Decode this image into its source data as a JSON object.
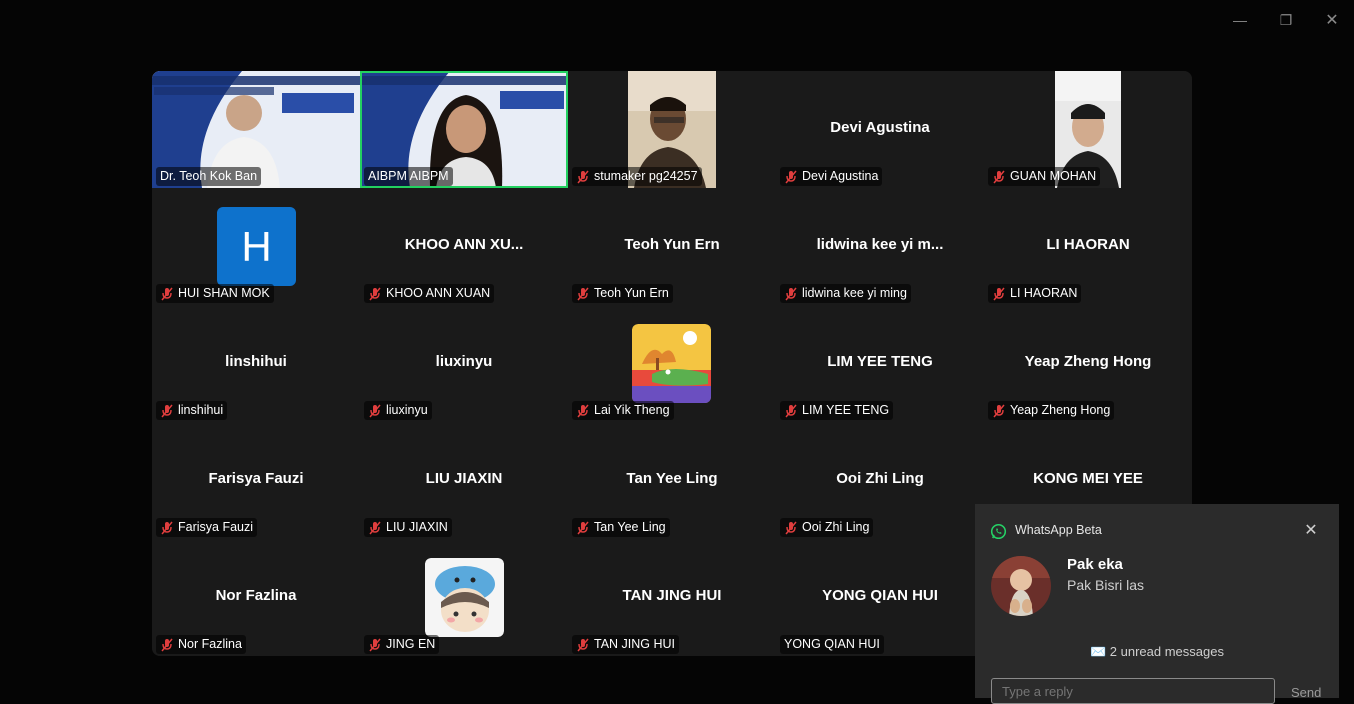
{
  "window": {
    "min_icon": "—",
    "max_icon": "❐",
    "close_icon": "✕"
  },
  "tiles": [
    {
      "name": "Dr. Teoh Kok Ban",
      "label": "Dr. Teoh Kok Ban",
      "muted": false,
      "type": "video"
    },
    {
      "name": "AIBPM AIBPM",
      "label": "AIBPM AIBPM",
      "muted": false,
      "type": "video",
      "active": true
    },
    {
      "name": "stumaker pg24257",
      "label": "stumaker pg24257",
      "muted": true,
      "type": "video"
    },
    {
      "name": "Devi Agustina",
      "label": "Devi Agustina",
      "muted": true,
      "type": "name"
    },
    {
      "name": "GUAN MOHAN",
      "label": "GUAN MOHAN",
      "muted": true,
      "type": "video"
    },
    {
      "name": "HUI SHAN MOK",
      "label": "HUI SHAN MOK",
      "muted": true,
      "type": "avatar",
      "avatar_letter": "H"
    },
    {
      "name": "KHOO ANN XU...",
      "label": "KHOO ANN XUAN",
      "muted": true,
      "type": "name"
    },
    {
      "name": "Teoh Yun Ern",
      "label": "Teoh Yun Ern",
      "muted": true,
      "type": "name"
    },
    {
      "name": "lidwina kee yi m...",
      "label": "lidwina kee yi ming",
      "muted": true,
      "type": "name"
    },
    {
      "name": "LI HAORAN",
      "label": "LI HAORAN",
      "muted": true,
      "type": "name"
    },
    {
      "name": "linshihui",
      "label": "linshihui",
      "muted": true,
      "type": "name"
    },
    {
      "name": "liuxinyu",
      "label": "liuxinyu",
      "muted": true,
      "type": "name"
    },
    {
      "name": "Lai Yik Theng",
      "label": "Lai Yik Theng",
      "muted": true,
      "type": "picture"
    },
    {
      "name": "LIM YEE TENG",
      "label": "LIM YEE TENG",
      "muted": true,
      "type": "name"
    },
    {
      "name": "Yeap Zheng Hong",
      "label": "Yeap Zheng Hong",
      "muted": true,
      "type": "name"
    },
    {
      "name": "Farisya Fauzi",
      "label": "Farisya Fauzi",
      "muted": true,
      "type": "name"
    },
    {
      "name": "LIU JIAXIN",
      "label": "LIU JIAXIN",
      "muted": true,
      "type": "name"
    },
    {
      "name": "Tan Yee Ling",
      "label": "Tan Yee Ling",
      "muted": true,
      "type": "name"
    },
    {
      "name": "Ooi Zhi Ling",
      "label": "Ooi Zhi Ling",
      "muted": true,
      "type": "name"
    },
    {
      "name": "KONG MEI YEE",
      "label": "KONG MEI YEE",
      "muted": true,
      "type": "name"
    },
    {
      "name": "Nor Fazlina",
      "label": "Nor Fazlina",
      "muted": true,
      "type": "name"
    },
    {
      "name": "JING EN",
      "label": "JING EN",
      "muted": true,
      "type": "picture"
    },
    {
      "name": "TAN JING HUI",
      "label": "TAN JING HUI",
      "muted": true,
      "type": "name"
    },
    {
      "name": "YONG QIAN HUI",
      "label": "YONG QIAN HUI",
      "muted": false,
      "type": "name"
    }
  ],
  "notification": {
    "app_name": "WhatsApp Beta",
    "close_icon": "✕",
    "sender": "Pak eka",
    "message": "Pak Bisri las",
    "unread": "✉️ 2 unread messages",
    "reply_placeholder": "Type a reply",
    "send_label": "Send"
  },
  "colors": {
    "active_speaker": "#23d160",
    "tile_bg": "#1a1a1a",
    "avatar_blue": "#0e72cc",
    "muted_red": "#e03e3e"
  }
}
